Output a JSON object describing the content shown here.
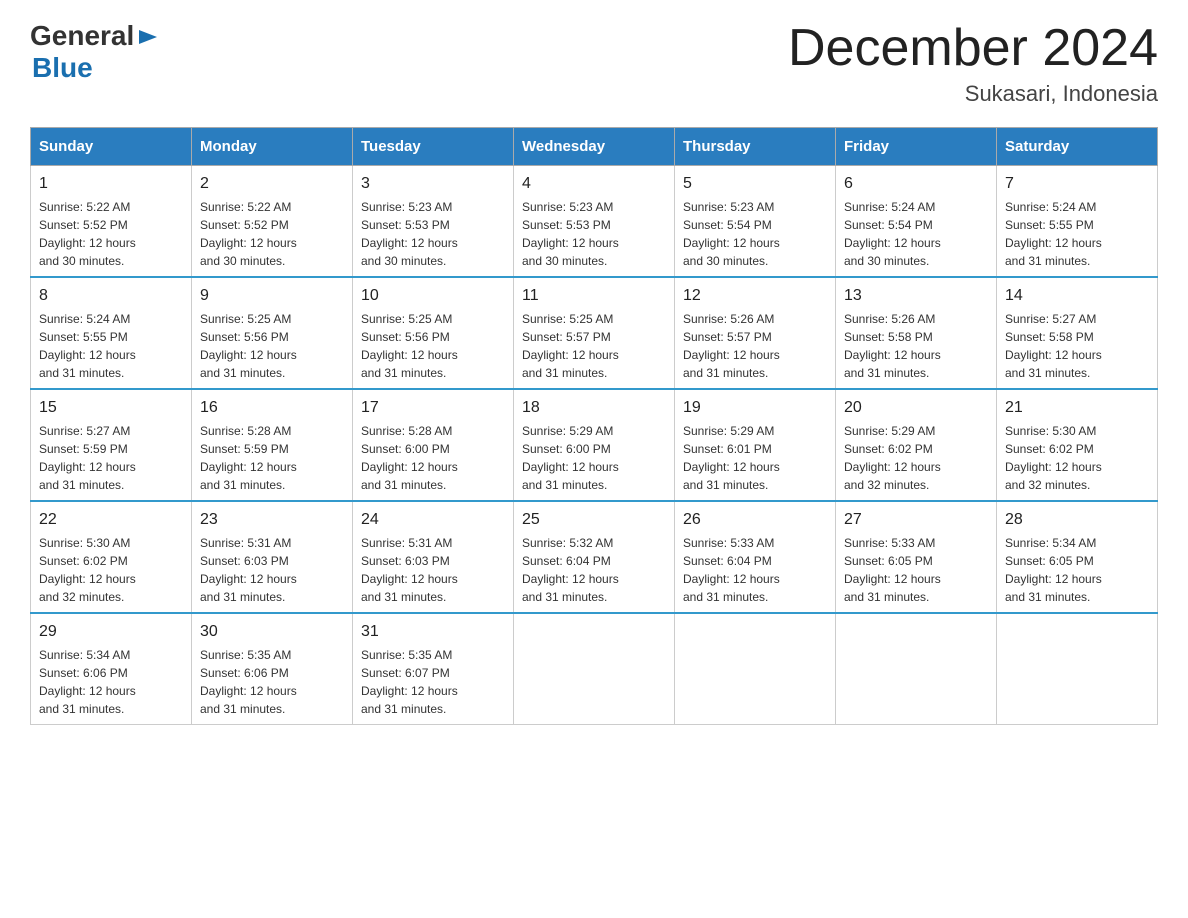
{
  "logo": {
    "text_general": "General",
    "text_blue": "Blue",
    "triangle_char": "▶"
  },
  "header": {
    "month_year": "December 2024",
    "location": "Sukasari, Indonesia"
  },
  "weekdays": [
    "Sunday",
    "Monday",
    "Tuesday",
    "Wednesday",
    "Thursday",
    "Friday",
    "Saturday"
  ],
  "weeks": [
    [
      {
        "day": "1",
        "sunrise": "5:22 AM",
        "sunset": "5:52 PM",
        "daylight": "12 hours and 30 minutes."
      },
      {
        "day": "2",
        "sunrise": "5:22 AM",
        "sunset": "5:52 PM",
        "daylight": "12 hours and 30 minutes."
      },
      {
        "day": "3",
        "sunrise": "5:23 AM",
        "sunset": "5:53 PM",
        "daylight": "12 hours and 30 minutes."
      },
      {
        "day": "4",
        "sunrise": "5:23 AM",
        "sunset": "5:53 PM",
        "daylight": "12 hours and 30 minutes."
      },
      {
        "day": "5",
        "sunrise": "5:23 AM",
        "sunset": "5:54 PM",
        "daylight": "12 hours and 30 minutes."
      },
      {
        "day": "6",
        "sunrise": "5:24 AM",
        "sunset": "5:54 PM",
        "daylight": "12 hours and 30 minutes."
      },
      {
        "day": "7",
        "sunrise": "5:24 AM",
        "sunset": "5:55 PM",
        "daylight": "12 hours and 31 minutes."
      }
    ],
    [
      {
        "day": "8",
        "sunrise": "5:24 AM",
        "sunset": "5:55 PM",
        "daylight": "12 hours and 31 minutes."
      },
      {
        "day": "9",
        "sunrise": "5:25 AM",
        "sunset": "5:56 PM",
        "daylight": "12 hours and 31 minutes."
      },
      {
        "day": "10",
        "sunrise": "5:25 AM",
        "sunset": "5:56 PM",
        "daylight": "12 hours and 31 minutes."
      },
      {
        "day": "11",
        "sunrise": "5:25 AM",
        "sunset": "5:57 PM",
        "daylight": "12 hours and 31 minutes."
      },
      {
        "day": "12",
        "sunrise": "5:26 AM",
        "sunset": "5:57 PM",
        "daylight": "12 hours and 31 minutes."
      },
      {
        "day": "13",
        "sunrise": "5:26 AM",
        "sunset": "5:58 PM",
        "daylight": "12 hours and 31 minutes."
      },
      {
        "day": "14",
        "sunrise": "5:27 AM",
        "sunset": "5:58 PM",
        "daylight": "12 hours and 31 minutes."
      }
    ],
    [
      {
        "day": "15",
        "sunrise": "5:27 AM",
        "sunset": "5:59 PM",
        "daylight": "12 hours and 31 minutes."
      },
      {
        "day": "16",
        "sunrise": "5:28 AM",
        "sunset": "5:59 PM",
        "daylight": "12 hours and 31 minutes."
      },
      {
        "day": "17",
        "sunrise": "5:28 AM",
        "sunset": "6:00 PM",
        "daylight": "12 hours and 31 minutes."
      },
      {
        "day": "18",
        "sunrise": "5:29 AM",
        "sunset": "6:00 PM",
        "daylight": "12 hours and 31 minutes."
      },
      {
        "day": "19",
        "sunrise": "5:29 AM",
        "sunset": "6:01 PM",
        "daylight": "12 hours and 31 minutes."
      },
      {
        "day": "20",
        "sunrise": "5:29 AM",
        "sunset": "6:02 PM",
        "daylight": "12 hours and 32 minutes."
      },
      {
        "day": "21",
        "sunrise": "5:30 AM",
        "sunset": "6:02 PM",
        "daylight": "12 hours and 32 minutes."
      }
    ],
    [
      {
        "day": "22",
        "sunrise": "5:30 AM",
        "sunset": "6:02 PM",
        "daylight": "12 hours and 32 minutes."
      },
      {
        "day": "23",
        "sunrise": "5:31 AM",
        "sunset": "6:03 PM",
        "daylight": "12 hours and 31 minutes."
      },
      {
        "day": "24",
        "sunrise": "5:31 AM",
        "sunset": "6:03 PM",
        "daylight": "12 hours and 31 minutes."
      },
      {
        "day": "25",
        "sunrise": "5:32 AM",
        "sunset": "6:04 PM",
        "daylight": "12 hours and 31 minutes."
      },
      {
        "day": "26",
        "sunrise": "5:33 AM",
        "sunset": "6:04 PM",
        "daylight": "12 hours and 31 minutes."
      },
      {
        "day": "27",
        "sunrise": "5:33 AM",
        "sunset": "6:05 PM",
        "daylight": "12 hours and 31 minutes."
      },
      {
        "day": "28",
        "sunrise": "5:34 AM",
        "sunset": "6:05 PM",
        "daylight": "12 hours and 31 minutes."
      }
    ],
    [
      {
        "day": "29",
        "sunrise": "5:34 AM",
        "sunset": "6:06 PM",
        "daylight": "12 hours and 31 minutes."
      },
      {
        "day": "30",
        "sunrise": "5:35 AM",
        "sunset": "6:06 PM",
        "daylight": "12 hours and 31 minutes."
      },
      {
        "day": "31",
        "sunrise": "5:35 AM",
        "sunset": "6:07 PM",
        "daylight": "12 hours and 31 minutes."
      },
      null,
      null,
      null,
      null
    ]
  ],
  "labels": {
    "sunrise": "Sunrise:",
    "sunset": "Sunset:",
    "daylight": "Daylight:"
  }
}
